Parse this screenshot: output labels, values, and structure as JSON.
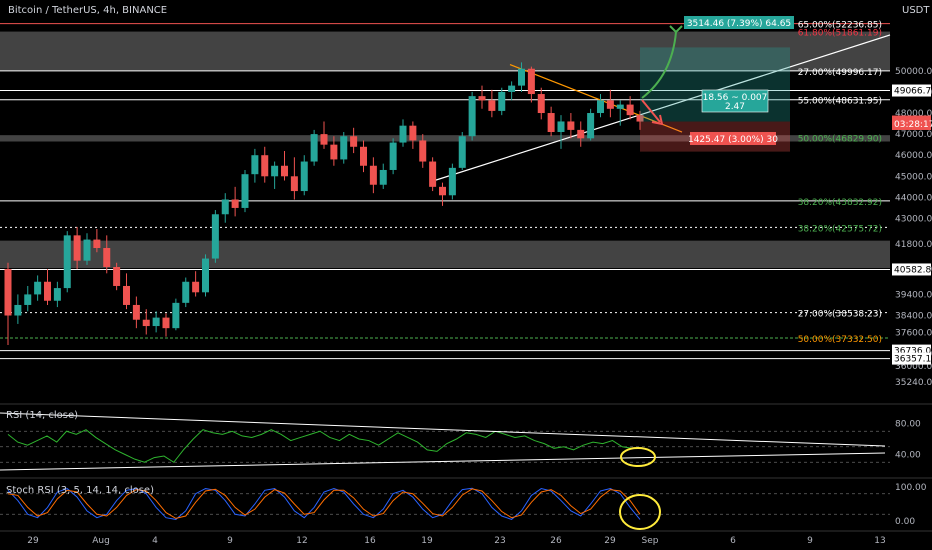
{
  "header": {
    "title": "Bitcoin / TetherUS, 4h, BINANCE",
    "currency": "USDT"
  },
  "colors": {
    "background": "#000000",
    "bull": "#26a69a",
    "bear": "#ef5350",
    "zone": "#4a4a4a",
    "fib_green": "#4caf50",
    "fib_orange": "#ff9800",
    "fib_red": "#f23645",
    "rsi": "#2fb52f",
    "stoch_k": "#2962ff",
    "stoch_d": "#ff6d00",
    "annotation": "#ffeb3b"
  },
  "price_axis": {
    "ticks": [
      "50000.00",
      "49000.00",
      "48000.00",
      "47000.00",
      "46000.00",
      "45000.00",
      "44000.00",
      "43000.00",
      "41800.00",
      "40600.00",
      "39400.00",
      "38400.00",
      "37600.00",
      "36600.00",
      "36000.00",
      "35240.00"
    ],
    "labels": [
      {
        "price": 49066.76,
        "text": "49066.76",
        "bg": "#ffffff",
        "fg": "#000000"
      },
      {
        "price": 47595.67,
        "text": "47595.67",
        "bg": "#ef5350",
        "fg": "#ffffff"
      },
      {
        "price": 47480,
        "text": "03:28:17",
        "bg": "#ef5350",
        "fg": "#ffffff"
      },
      {
        "price": 40582.81,
        "text": "40582.81",
        "bg": "#ffffff",
        "fg": "#000000"
      },
      {
        "price": 36736.0,
        "text": "36736.00",
        "bg": "#ffffff",
        "fg": "#000000"
      },
      {
        "price": 36357.11,
        "text": "36357.11",
        "bg": "#ffffff",
        "fg": "#000000"
      }
    ]
  },
  "fib_labels": [
    {
      "text": "65.00%(52236.85)",
      "price": 52236.85,
      "color": "#ffffff"
    },
    {
      "text": "61.80%(51861.19)",
      "price": 51861.19,
      "color": "#f23645"
    },
    {
      "text": "27.00%(49996.17)",
      "price": 49996.17,
      "color": "#ffffff"
    },
    {
      "text": "55.00%(48631.95)",
      "price": 48631.95,
      "color": "#ffffff"
    },
    {
      "text": "50.00%(46829.90)",
      "price": 46829.9,
      "color": "#4caf50"
    },
    {
      "text": "38.20%(43832.92)",
      "price": 43832.92,
      "color": "#4caf50"
    },
    {
      "text": "38.20%(42575.72)",
      "price": 42575.72,
      "color": "#4caf50"
    },
    {
      "text": "27.00%(38538.23)",
      "price": 38538.23,
      "color": "#ffffff"
    },
    {
      "text": "50.00%(37332.50)",
      "price": 37332.5,
      "color": "#ff9800"
    }
  ],
  "position_tool": {
    "target_label": "3514.46 (7.39%) 64.65",
    "stop_label": "1425.47 (3.00%) 30",
    "ratio_line1": "18.56 ~ 0.007",
    "ratio_line2": "2.47"
  },
  "time_axis": {
    "labels": [
      "29",
      "Aug",
      "4",
      "9",
      "12",
      "16",
      "19",
      "23",
      "26",
      "29",
      "Sep",
      "6",
      "9",
      "13"
    ]
  },
  "chart_data": [
    {
      "type": "candlestick",
      "title": "Bitcoin / TetherUS, 4h, BINANCE",
      "ylim": [
        35200,
        52600
      ],
      "current_price": 47595.67,
      "ohlc": [
        [
          40600,
          40900,
          37000,
          38400
        ],
        [
          38400,
          39400,
          38000,
          38900
        ],
        [
          38900,
          39800,
          38600,
          39400
        ],
        [
          39400,
          40300,
          39100,
          40000
        ],
        [
          40000,
          40600,
          38900,
          39100
        ],
        [
          39100,
          40000,
          38800,
          39700
        ],
        [
          39700,
          42400,
          39500,
          42200
        ],
        [
          42200,
          42600,
          40600,
          41000
        ],
        [
          41000,
          42300,
          40800,
          42000
        ],
        [
          42000,
          42500,
          41400,
          41600
        ],
        [
          41600,
          42200,
          40400,
          40700
        ],
        [
          40700,
          40900,
          39600,
          39800
        ],
        [
          39800,
          40400,
          38700,
          38900
        ],
        [
          38900,
          39300,
          37800,
          38200
        ],
        [
          38200,
          38700,
          37500,
          37900
        ],
        [
          37900,
          38600,
          37600,
          38300
        ],
        [
          38300,
          38500,
          37400,
          37800
        ],
        [
          37800,
          39200,
          37700,
          39000
        ],
        [
          39000,
          40200,
          38800,
          40000
        ],
        [
          40000,
          40500,
          39300,
          39500
        ],
        [
          39500,
          41300,
          39300,
          41100
        ],
        [
          41100,
          43400,
          40900,
          43200
        ],
        [
          43200,
          44200,
          42800,
          43900
        ],
        [
          43900,
          44500,
          43100,
          43500
        ],
        [
          43500,
          45300,
          43300,
          45100
        ],
        [
          45100,
          46300,
          44700,
          46000
        ],
        [
          46000,
          46400,
          44700,
          45000
        ],
        [
          45000,
          45700,
          44400,
          45500
        ],
        [
          45500,
          46200,
          44800,
          45000
        ],
        [
          45000,
          45900,
          43900,
          44300
        ],
        [
          44300,
          46000,
          44100,
          45700
        ],
        [
          45700,
          47200,
          45500,
          47000
        ],
        [
          47000,
          47600,
          46300,
          46500
        ],
        [
          46500,
          46900,
          45500,
          45800
        ],
        [
          45800,
          47100,
          45600,
          46900
        ],
        [
          46900,
          47300,
          46100,
          46400
        ],
        [
          46400,
          46700,
          45200,
          45500
        ],
        [
          45500,
          45900,
          44200,
          44600
        ],
        [
          44600,
          45600,
          44400,
          45300
        ],
        [
          45300,
          46800,
          45100,
          46600
        ],
        [
          46600,
          47700,
          46400,
          47400
        ],
        [
          47400,
          47600,
          46300,
          46700
        ],
        [
          46700,
          47000,
          45400,
          45700
        ],
        [
          45700,
          45900,
          44300,
          44500
        ],
        [
          44500,
          44700,
          43600,
          44100
        ],
        [
          44100,
          45600,
          43900,
          45400
        ],
        [
          45400,
          47100,
          45300,
          46900
        ],
        [
          46900,
          49000,
          46700,
          48800
        ],
        [
          48800,
          49300,
          48200,
          48600
        ],
        [
          48600,
          49100,
          47800,
          48100
        ],
        [
          48100,
          49200,
          47900,
          49000
        ],
        [
          49000,
          49500,
          48600,
          49300
        ],
        [
          49300,
          50400,
          49000,
          50100
        ],
        [
          50100,
          50200,
          48500,
          48900
        ],
        [
          48900,
          49200,
          47700,
          48000
        ],
        [
          48000,
          48300,
          46900,
          47100
        ],
        [
          47100,
          47900,
          46300,
          47600
        ],
        [
          47600,
          48000,
          46800,
          47200
        ],
        [
          47200,
          47600,
          46400,
          46800
        ],
        [
          46800,
          48200,
          46700,
          48000
        ],
        [
          48000,
          48900,
          47800,
          48600
        ],
        [
          48600,
          49100,
          47800,
          48200
        ],
        [
          48200,
          48600,
          47400,
          48400
        ],
        [
          48400,
          48800,
          47700,
          47900
        ],
        [
          47900,
          48100,
          47200,
          47595.67
        ]
      ]
    },
    {
      "type": "line",
      "title": "RSI (14, close)",
      "ylim": [
        20,
        100
      ],
      "levels": [
        70,
        50,
        30
      ],
      "ticks": [
        "80.00",
        "40.00"
      ],
      "series": [
        {
          "name": "RSI",
          "values": [
            66,
            56,
            52,
            58,
            64,
            56,
            70,
            66,
            72,
            62,
            54,
            46,
            40,
            34,
            30,
            36,
            38,
            30,
            46,
            60,
            72,
            68,
            66,
            70,
            64,
            62,
            66,
            72,
            66,
            58,
            62,
            66,
            70,
            62,
            58,
            66,
            60,
            58,
            52,
            60,
            68,
            62,
            56,
            46,
            44,
            54,
            60,
            68,
            66,
            62,
            70,
            66,
            62,
            64,
            58,
            54,
            48,
            50,
            46,
            52,
            56,
            54,
            58,
            50,
            48
          ]
        }
      ]
    },
    {
      "type": "line",
      "title": "Stoch RSI (3, 5, 14, 14, close)",
      "ylim": [
        -20,
        120
      ],
      "levels": [
        80,
        20
      ],
      "ticks": [
        "100.00",
        "0.00"
      ],
      "series": [
        {
          "name": "K",
          "values": [
            90,
            60,
            20,
            10,
            40,
            85,
            95,
            70,
            30,
            10,
            20,
            60,
            90,
            95,
            80,
            40,
            10,
            5,
            30,
            80,
            95,
            90,
            60,
            20,
            15,
            50,
            90,
            95,
            70,
            30,
            10,
            40,
            85,
            95,
            85,
            50,
            20,
            10,
            35,
            80,
            90,
            70,
            35,
            10,
            20,
            60,
            92,
            96,
            80,
            40,
            15,
            5,
            30,
            75,
            95,
            88,
            60,
            30,
            15,
            50,
            88,
            95,
            80,
            40,
            5
          ]
        },
        {
          "name": "D",
          "values": [
            80,
            75,
            40,
            15,
            25,
            65,
            90,
            85,
            50,
            20,
            15,
            40,
            75,
            92,
            88,
            60,
            25,
            8,
            15,
            55,
            88,
            93,
            75,
            40,
            18,
            35,
            70,
            92,
            82,
            50,
            20,
            25,
            62,
            90,
            90,
            68,
            35,
            15,
            22,
            60,
            85,
            80,
            52,
            22,
            15,
            40,
            76,
            94,
            88,
            60,
            28,
            10,
            18,
            55,
            85,
            92,
            75,
            45,
            22,
            35,
            70,
            92,
            88,
            60,
            20
          ]
        }
      ]
    }
  ]
}
